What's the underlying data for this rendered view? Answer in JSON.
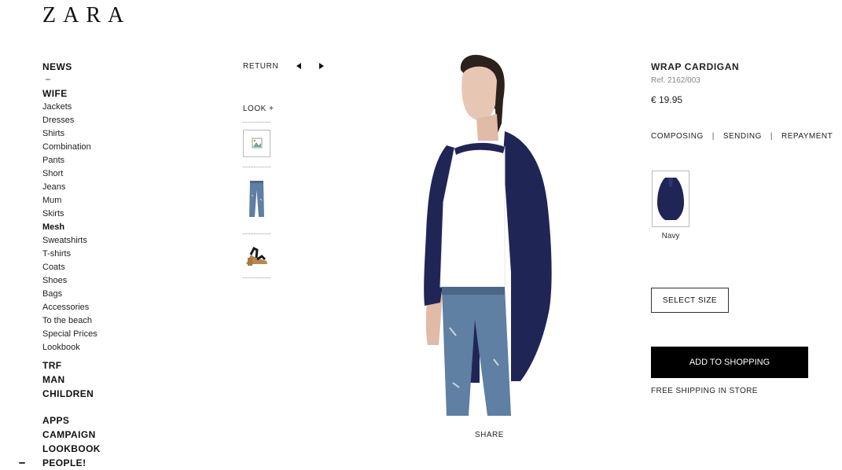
{
  "brand": "ZARA",
  "nav": {
    "news": "NEWS",
    "dash": "–",
    "wife": "WIFE",
    "categories": [
      "Jackets",
      "Dresses",
      "Shirts",
      "Combination",
      "Pants",
      "Short",
      "Jeans",
      "Mum",
      "Skirts",
      "Mesh",
      "Sweatshirts",
      "T-shirts",
      "Coats",
      "Shoes",
      "Bags",
      "Accessories",
      "To the beach",
      "Special Prices",
      "Lookbook"
    ],
    "sections": [
      "TRF",
      "MAN",
      "CHILDREN"
    ],
    "extras": [
      "APPS",
      "CAMPAIGN",
      "LOOKBOOK",
      "PEOPLE!"
    ]
  },
  "gallery": {
    "return_label": "RETURN",
    "look_label": "LOOK +",
    "share_label": "SHARE"
  },
  "product": {
    "title": "WRAP CARDIGAN",
    "ref": "Ref. 2162/003",
    "price": "€ 19.95",
    "tabs": [
      "COMPOSING",
      "SENDING",
      "REPAYMENT"
    ],
    "color_name": "Navy",
    "select_size": "SELECT SIZE",
    "add_to_cart": "ADD TO SHOPPING",
    "shipping_note": "FREE SHIPPING IN STORE"
  },
  "colors": {
    "cardigan": "#1f2656",
    "denim": "#5f7fa3",
    "button": "#000000"
  }
}
